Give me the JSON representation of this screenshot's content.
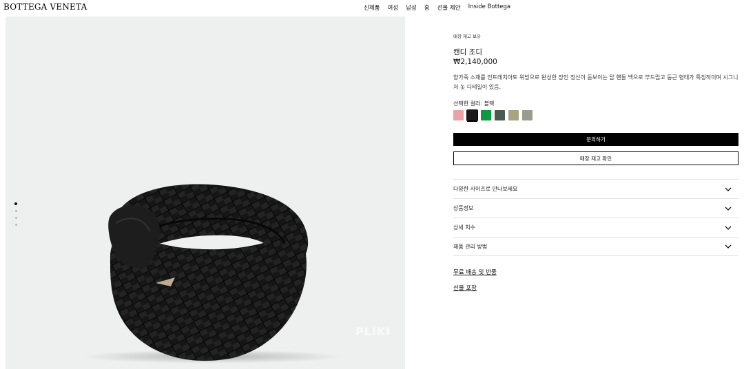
{
  "header": {
    "logo": "BOTTEGA VENETA",
    "nav": [
      "신제품",
      "여성",
      "남성",
      "홈",
      "선물 제안",
      "Inside Bottega"
    ]
  },
  "media": {
    "watermark": "PLIKI",
    "pager_count": 4,
    "pager_active": 0
  },
  "product": {
    "stock": "매장 재고 보유",
    "name": "캔디 조디",
    "price": "₩2,140,000",
    "description": "양가죽 소재를 인트레치아토 위빙으로 완성한 장인 정신이 돋보이는 탑 핸들 백으로 부드럽고 둥근 형태가 특징적이며 시그니처 놋 디테일이 있음.",
    "color_label": "선택한 컬러: 블랙",
    "swatch_colors": [
      "#e9a2a8",
      "#1a1a1a",
      "#0b9a3f",
      "#4a5a4f",
      "#a7a581",
      "#9a9c8c"
    ],
    "selected_swatch": 1
  },
  "actions": {
    "inquire": "문의하기",
    "check_stock": "매장 재고 확인"
  },
  "accordion": [
    "다양한 사이즈로 만나보세요",
    "상품정보",
    "상세 치수",
    "제품 관리 방법"
  ],
  "links": {
    "shipping": "무료 배송 및 반품",
    "gift_wrap": "선물 포장"
  }
}
